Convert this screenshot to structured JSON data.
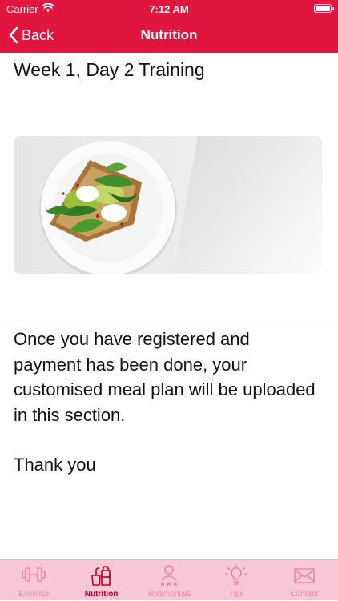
{
  "status": {
    "carrier": "Carrier",
    "time": "7:12 AM"
  },
  "nav": {
    "back_label": "Back",
    "title": "Nutrition"
  },
  "content": {
    "title": "Week 1, Day 2 Training",
    "message": "Once you have registered and payment has been done, your customised meal plan will be uploaded in this section.",
    "thanks": "Thank you"
  },
  "tabs": [
    {
      "label": "Exercise",
      "icon": "dumbbell-icon",
      "active": false
    },
    {
      "label": "Nutrition",
      "icon": "nutrition-icon",
      "active": true
    },
    {
      "label": "Testimonials",
      "icon": "testimonials-icon",
      "active": false
    },
    {
      "label": "Tips",
      "icon": "lightbulb-icon",
      "active": false
    },
    {
      "label": "Contact",
      "icon": "envelope-icon",
      "active": false
    }
  ],
  "colors": {
    "accent": "#e0163f",
    "tab_bar_bg": "#f9c8d7",
    "tab_inactive": "#e58aa6",
    "tab_active": "#b3002e"
  }
}
